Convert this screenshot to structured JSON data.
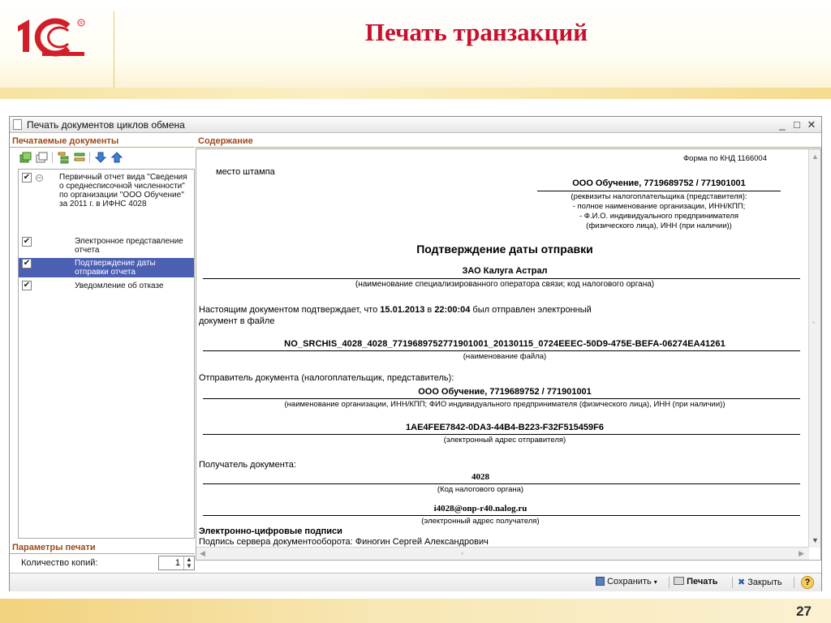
{
  "slide": {
    "title": "Печать транзакций",
    "page_number": "27",
    "logo_text": "1С"
  },
  "window": {
    "title": "Печать документов циклов обмена",
    "controls": {
      "minimize": "_",
      "maximize": "□",
      "close": "✕"
    }
  },
  "left_panel": {
    "header": "Печатаемые документы",
    "toolbar_icons": [
      "check-all-icon",
      "uncheck-all-icon",
      "expand-icon",
      "collapse-icon",
      "move-down-icon",
      "move-up-icon"
    ],
    "items": [
      {
        "label": "Первичный отчет вида \"Сведения о среднесписочной численности\" по организации \"ООО Обучение\" за 2011 г. в ИФНС 4028",
        "checked": true,
        "selected": false
      },
      {
        "label": "Электронное представление отчета",
        "checked": true,
        "selected": false
      },
      {
        "label": "Подтверждение даты отправки отчета",
        "checked": true,
        "selected": true
      },
      {
        "label": "Уведомление об отказе",
        "checked": true,
        "selected": false
      }
    ],
    "params_header": "Параметры печати",
    "copies_label": "Количество копий:",
    "copies_value": "1"
  },
  "right_panel": {
    "header": "Содержание",
    "document": {
      "form_code": "Форма по КНД 1166004",
      "stamp_place": "место штампа",
      "taxpayer": "ООО Обучение, 7719689752 / 771901001",
      "taxpayer_hint": [
        "(реквизиты налогоплательщика (представителя):",
        "- полное наименование организации, ИНН/КПП;",
        "- Ф.И.О. индивидуального предпринимателя",
        "(физического лица), ИНН (при наличии))"
      ],
      "heading": "Подтверждение даты отправки",
      "operator": "ЗАО Калуга Астрал",
      "operator_hint": "(наименование специализированного оператора связи; код налогового органа)",
      "confirm_text_1": "Настоящим документом подтверждает, что",
      "confirm_date": "15.01.2013",
      "confirm_in": "в",
      "confirm_time": "22:00:04",
      "confirm_text_2": "был отправлен электронный",
      "confirm_text_3": "документ в файле",
      "file_name": "NO_SRCHIS_4028_4028_7719689752771901001_20130115_0724EEEC-50D9-475E-BEFA-06274EA41261",
      "file_hint": "(наименование файла)",
      "sender_label": "Отправитель документа (налогоплательщик, представитель):",
      "sender": "ООО Обучение, 7719689752 / 771901001",
      "sender_hint": "(наименование организации, ИНН/КПП; ФИО индивидуального предпринимателя (физического лица), ИНН (при наличии))",
      "sender_address": "1AE4FEE7842-0DA3-44B4-B223-F32F515459F6",
      "sender_address_hint": "(электронный адрес отправителя)",
      "recipient_label": "Получатель документа:",
      "recipient_code": "4028",
      "recipient_code_hint": "(Код налогового органа)",
      "recipient_address": "i4028@onp-r40.nalog.ru",
      "recipient_address_hint": "(электронный адрес получателя)",
      "signatures_heading": "Электронно-цифровые подписи",
      "signature_line": "Подпись сервера документооборота: Финогин Сергей Александрович"
    }
  },
  "statusbar": {
    "save": "Сохранить",
    "print": "Печать",
    "close": "Закрыть",
    "help": "?"
  },
  "colors": {
    "title_red": "#c8102e",
    "section_header": "#9c4a1c",
    "selection": "#4b5fb3"
  }
}
